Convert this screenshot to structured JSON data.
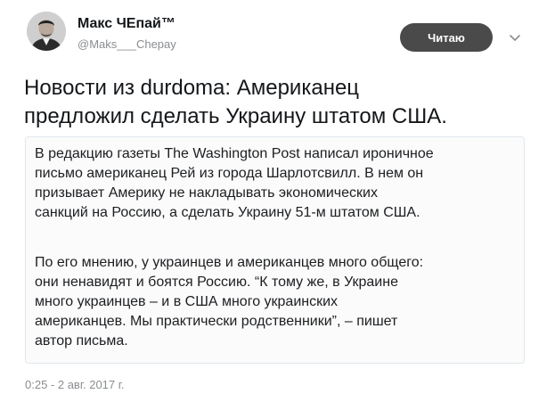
{
  "author": {
    "name": "Макс ЧЕпай™",
    "handle": "@Maks___Chepay"
  },
  "follow_button": {
    "label": "Читаю"
  },
  "tweet": {
    "text_lines": [
      "Новости из durdoma: Американец",
      "предложил сделать Украину штатом США."
    ]
  },
  "card": {
    "paragraph1_lines": [
      "В редакцию газеты The Washington Post написал ироничное",
      "письмо американец Рей из города Шарлотсвилл. В нем он",
      "призывает Америку не накладывать экономических",
      "санкций на Россию, а сделать Украину 51-м штатом США."
    ],
    "paragraph2_lines": [
      "По его мнению, у украинцев и американцев много общего:",
      "они ненавидят и боятся Россию. “К тому же, в Украине",
      "много украинцев – и в США много украинских",
      "американцев. Мы практически родственники”, – пишет",
      "автор письма."
    ]
  },
  "timestamp": "0:25 - 2 авг. 2017 г.",
  "icons": {
    "avatar": "user-avatar",
    "menu": "chevron-down-icon"
  },
  "colors": {
    "follow_button_bg": "#4a4a4a",
    "secondary_text": "#8a8d91",
    "card_border": "#e1e8ed"
  }
}
